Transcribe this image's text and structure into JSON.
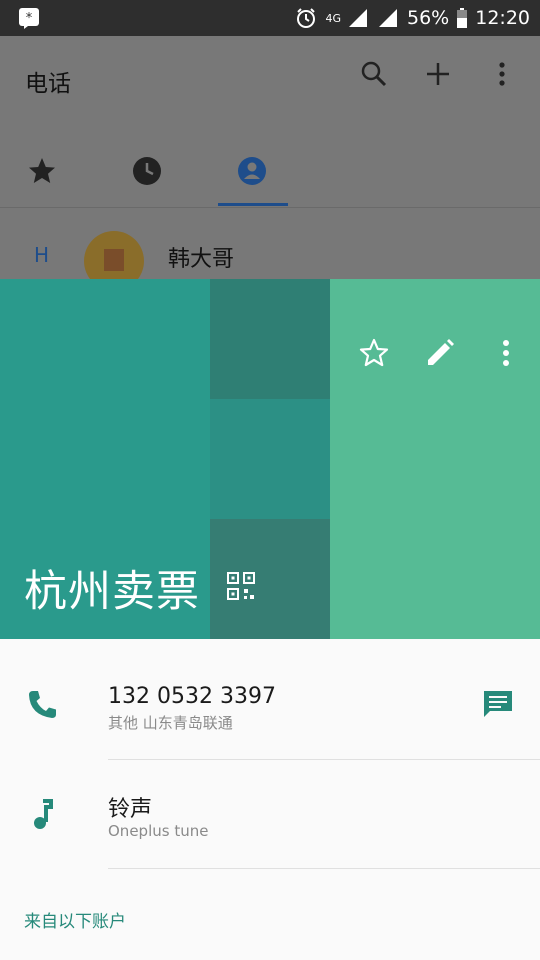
{
  "status_bar": {
    "network": "4G",
    "battery": "56%",
    "time": "12:20"
  },
  "app": {
    "title": "电话",
    "contact_list": {
      "section_letter": "H",
      "contact_name": "韩大哥"
    }
  },
  "contact_card": {
    "name": "杭州卖票",
    "phone": {
      "number": "132 0532 3397",
      "label": "其他  山东青岛联通"
    },
    "ringtone": {
      "title": "铃声",
      "value": "Oneplus tune"
    },
    "accounts_heading": "来自以下账户"
  },
  "colors": {
    "accent": "#26897a",
    "header_teal": "#2a9a8c",
    "header_green": "#56bb95",
    "tab_indicator": "#1e4d8b"
  }
}
